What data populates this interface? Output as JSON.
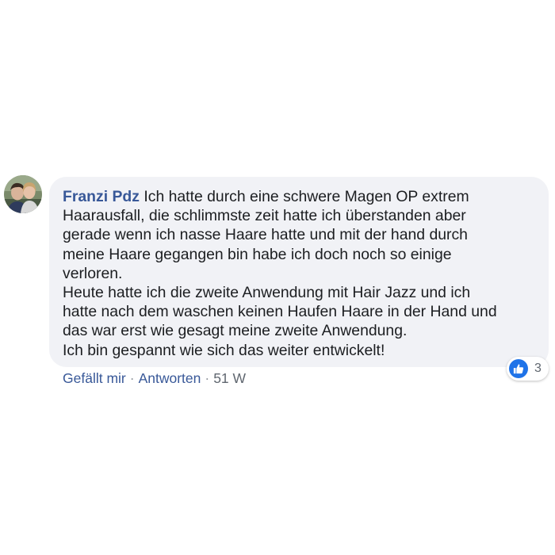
{
  "comment": {
    "author": "Franzi Pdz",
    "text_lines": [
      "Ich hatte durch eine schwere Magen OP extrem",
      "Haarausfall, die schlimmste zeit hatte ich überstanden aber",
      "gerade wenn ich nasse Haare hatte und mit der hand durch",
      "meine Haare gegangen bin habe ich doch noch so einige",
      "verloren.",
      "Heute hatte ich die zweite Anwendung mit Hair Jazz und ich",
      "hatte nach dem waschen keinen Haufen Haare in der Hand und",
      "das war erst wie gesagt meine zweite Anwendung.",
      "Ich bin gespannt wie sich das weiter entwickelt!"
    ],
    "reactions": {
      "icon": "like-icon",
      "count": "3"
    },
    "actions": {
      "like_label": "Gefällt mir",
      "reply_label": "Antworten",
      "separator": "·",
      "timestamp": "51 W"
    }
  },
  "colors": {
    "author_link": "#385898",
    "bubble_background": "#f1f2f6",
    "text": "#1c1e21",
    "like_blue": "#1f73e8",
    "meta_gray": "#606770"
  }
}
